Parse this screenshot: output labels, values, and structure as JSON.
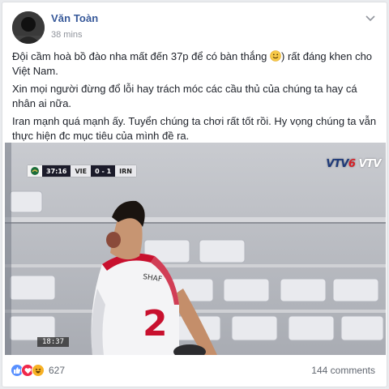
{
  "post": {
    "author": "Văn Toàn",
    "timestamp": "38 mins",
    "paragraphs": [
      {
        "before": "Đội cầm hoà bồ đào nha mất đến 37p để có bàn thắng ",
        "after": ") rất đáng khen cho Việt Nam."
      },
      {
        "text": "Xin mọi người đừng đổ lỗi hay trách móc các cầu thủ của chúng ta hay cá nhân ai nữa."
      },
      {
        "text": "Iran mạnh quá mạnh ấy. Tuyển chúng ta chơi rất tốt rồi. Hy vọng chúng ta vẫn thực hiện đc mục tiêu của mình đề ra."
      }
    ]
  },
  "video": {
    "scorebug": {
      "clock": "37:16",
      "home": "VIE",
      "score": "0 - 1",
      "away": "IRN"
    },
    "broadcaster": {
      "part1": "VTV",
      "part2": "6",
      "part3": "VTV"
    },
    "replay_clock": "18:37"
  },
  "footer": {
    "reaction_count": "627",
    "comments_label": "144 comments"
  },
  "colors": {
    "author": "#365899",
    "like": "#5890ff",
    "love": "#f0284a",
    "haha": "#f7b125"
  },
  "icons": [
    "avatar",
    "chevron-down-icon",
    "smiley-icon",
    "like-icon",
    "love-icon",
    "haha-icon"
  ]
}
